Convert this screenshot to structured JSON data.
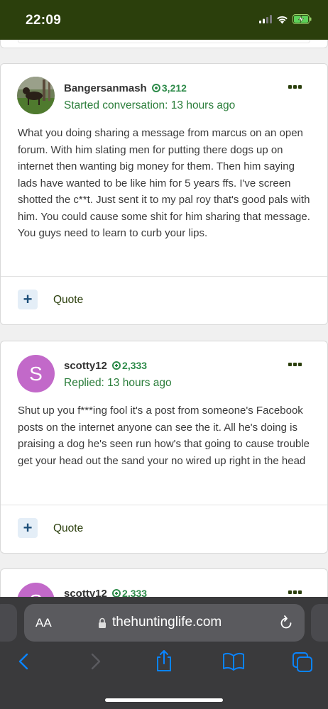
{
  "status_bar": {
    "time": "22:09"
  },
  "posts": [
    {
      "author": "Bangersanmash",
      "reputation": "3,212",
      "meta": "Started conversation: 13 hours ago",
      "body": "What you doing sharing a message from marcus on an open forum. With him slating men for putting there dogs up on internet then wanting big money for them. Then him saying lads have wanted to be like him for 5 years ffs. I've screen shotted the c**t. Just sent it to my pal roy that's good pals with him. You could cause some shit for him sharing that message. You guys need to learn to curb your lips.",
      "action_plus": "+",
      "action_label": "Quote"
    },
    {
      "author": "scotty12",
      "avatar_letter": "S",
      "reputation": "2,333",
      "meta": "Replied: 13 hours ago",
      "body": "Shut up you f***ing fool it's a post from someone's Facebook posts on the internet anyone can see the it. All he's doing is praising a dog he's seen run how's that going to cause trouble get your head out the sand your no wired up right in the head",
      "action_plus": "+",
      "action_label": "Quote"
    },
    {
      "author": "scotty12",
      "avatar_letter": "S",
      "reputation": "2,333"
    }
  ],
  "browser": {
    "text_size_label": "AA",
    "domain": "thehuntinglife.com"
  },
  "colors": {
    "status_bar": "#2b3f0c",
    "reputation": "#2e8b4a",
    "avatar_s": "#c269c9",
    "browser_accent": "#0a84ff"
  }
}
